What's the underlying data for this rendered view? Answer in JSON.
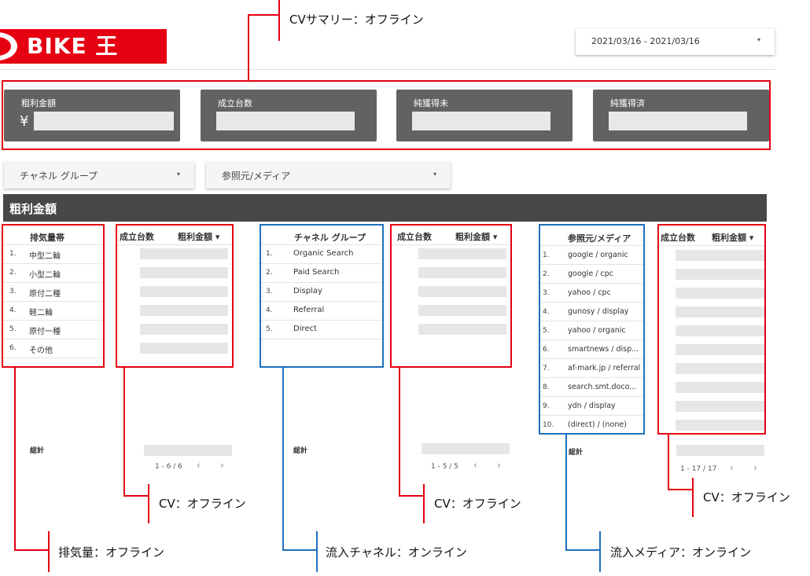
{
  "logo": {
    "text": "BIKE 王"
  },
  "date_range": {
    "value": "2021/03/16 - 2021/03/16",
    "arrow": "▾"
  },
  "summary_cards": [
    {
      "label": "粗利金額",
      "prefix": "¥"
    },
    {
      "label": "成立台数"
    },
    {
      "label": "純獲得未"
    },
    {
      "label": "純獲得済"
    }
  ],
  "filters": [
    {
      "label": "チャネル グループ",
      "arrow": "▾"
    },
    {
      "label": "参照元/メディア",
      "arrow": "▾"
    }
  ],
  "section": {
    "title": "粗利金額"
  },
  "table1": {
    "dim_header": "排気量帯",
    "metric_headers": [
      "成立台数",
      "粗利金額 ▾"
    ],
    "rows": [
      {
        "num": "1.",
        "label": "中型二輪"
      },
      {
        "num": "2.",
        "label": "小型二輪"
      },
      {
        "num": "3.",
        "label": "原付二種"
      },
      {
        "num": "4.",
        "label": "軽二輪"
      },
      {
        "num": "5.",
        "label": "原付一種"
      },
      {
        "num": "6.",
        "label": "その他"
      }
    ],
    "total_label": "総計",
    "pager": "1 - 6 / 6"
  },
  "table2": {
    "dim_header": "チャネル グループ",
    "metric_headers": [
      "成立台数",
      "粗利金額 ▾"
    ],
    "rows": [
      {
        "num": "1.",
        "label": "Organic Search"
      },
      {
        "num": "2.",
        "label": "Paid Search"
      },
      {
        "num": "3.",
        "label": "Display"
      },
      {
        "num": "4.",
        "label": "Referral"
      },
      {
        "num": "5.",
        "label": "Direct"
      }
    ],
    "total_label": "総計",
    "pager": "1 - 5 / 5"
  },
  "table3": {
    "dim_header": "参照元/メディア",
    "metric_headers": [
      "成立台数",
      "粗利金額 ▾"
    ],
    "rows": [
      {
        "num": "1.",
        "label": "google / organic"
      },
      {
        "num": "2.",
        "label": "google / cpc"
      },
      {
        "num": "3.",
        "label": "yahoo / cpc"
      },
      {
        "num": "4.",
        "label": "gunosy / display"
      },
      {
        "num": "5.",
        "label": "yahoo / organic"
      },
      {
        "num": "6.",
        "label": "smartnews / disp..."
      },
      {
        "num": "7.",
        "label": "af-mark.jp / referral"
      },
      {
        "num": "8.",
        "label": "search.smt.doco..."
      },
      {
        "num": "9.",
        "label": "ydn / display"
      },
      {
        "num": "10.",
        "label": "(direct) / (none)"
      }
    ],
    "total_label": "総計",
    "pager": "1 - 17 / 17"
  },
  "pager_arrows": {
    "prev": "‹",
    "next": "›"
  },
  "annotations": {
    "summary": "CVサマリー：オフライン",
    "cv1": "CV：オフライン",
    "cv2": "CV：オフライン",
    "cv3": "CV：オフライン",
    "displacement": "排気量：オフライン",
    "channel": "流入チャネル：オンライン",
    "media": "流入メディア：オンライン"
  }
}
